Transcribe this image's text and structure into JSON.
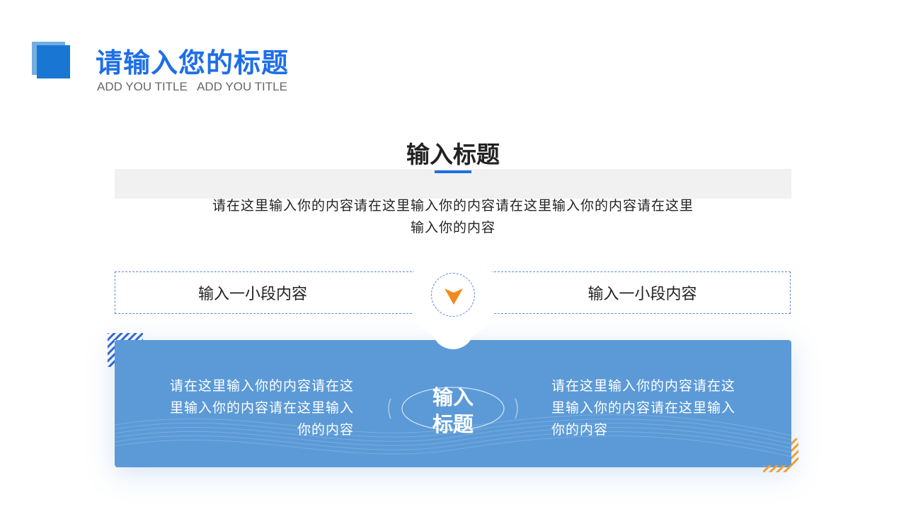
{
  "header": {
    "title": "请输入您的标题",
    "subtitle": "ADD YOU TITLE   ADD YOU TITLE"
  },
  "section": {
    "title": "输入标题",
    "intro": "请在这里输入你的内容请在这里输入你的内容请在这里输入你的内容请在这里输入你的内容"
  },
  "pills": {
    "left": "输入一小段内容",
    "right": "输入一小段内容"
  },
  "panel": {
    "left_text": "请在这里输入你的内容请在这里输入你的内容请在这里输入你的内容",
    "right_text": "请在这里输入你的内容请在这里输入你的内容请在这里输入你的内容",
    "center_title_line1": "输入",
    "center_title_line2": "标题"
  },
  "colors": {
    "accent_blue": "#1e6fe6",
    "panel_blue": "#5b9ad7",
    "arrow_orange": "#f08a1c",
    "stripe_orange": "#f0a030"
  },
  "icons": {
    "center_arrow": "chevron-down-icon"
  }
}
